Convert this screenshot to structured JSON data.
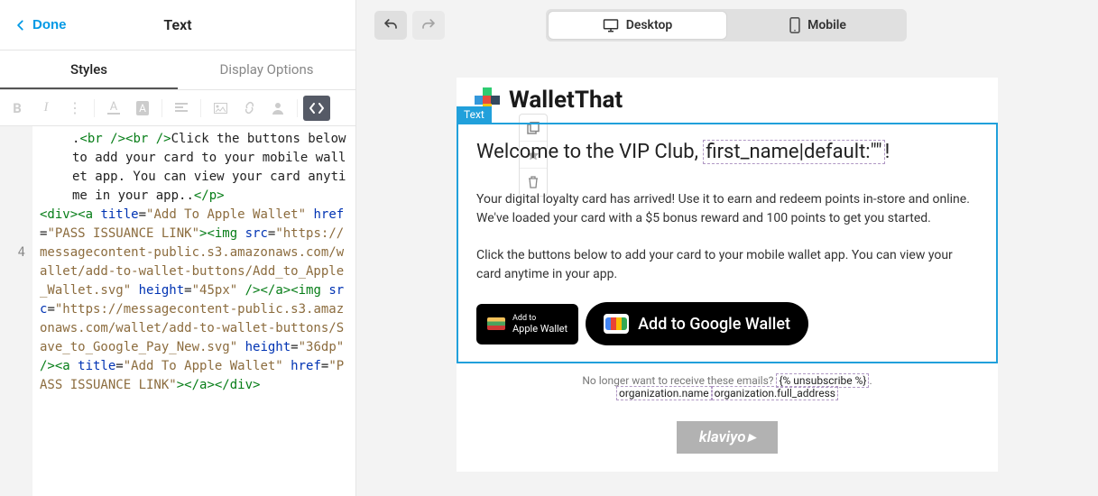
{
  "header": {
    "done_label": "Done",
    "title": "Text"
  },
  "tabs": {
    "styles": "Styles",
    "display": "Display Options"
  },
  "code": {
    "line_number": "4",
    "pre_text": ".",
    "br1": "<br />",
    "br2": "<br />",
    "click_text": "Click the buttons below to add your card to your mobile wallet app. You can view your card anytime in your app.",
    "p_close": "</p>",
    "div_open": "<div>",
    "a_open": "<a",
    "title_attr": " title",
    "eq": "=",
    "title_val": "\"Add To Apple Wallet\"",
    "href_attr": " href",
    "href_val": "\"PASS ISSUANCE LINK\"",
    "gt": ">",
    "img_open": "<img",
    "src_attr": " src",
    "src_val": "\"https://messagecontent-public.s3.amazonaws.com/wallet/add-to-wallet-buttons/Add_to_Apple_Wallet.svg\"",
    "height_attr": " height",
    "height_val": "\"45px\"",
    "self_close": " />",
    "a_close": "</a>",
    "src_val2": "\"https://messagecontent-public.s3.amazonaws.com/wallet/add-to-wallet-buttons/Save_to_Google_Pay_New.svg\"",
    "height_val2": "\"36dp\"",
    "href_val2": "\"PASS ISSUANCE LINK\"",
    "div_close": "</div>"
  },
  "device": {
    "desktop": "Desktop",
    "mobile": "Mobile"
  },
  "email": {
    "brand": "WalletThat",
    "text_label": "Text",
    "welcome_pre": "Welcome to the VIP Club, ",
    "welcome_token": "first_name|default:\"\"",
    "welcome_post": "!",
    "body1": "Your digital loyalty card has arrived! Use it to earn and redeem points in-store and online. We've loaded your card with a $5 bonus reward and 100 points to get you started.",
    "body2": "Click the buttons below to add your card to your mobile wallet app. You can view your card anytime in your app.",
    "apple_small": "Add to",
    "apple_big": "Apple Wallet",
    "google": "Add to Google Wallet",
    "footer_pre": "No longer want to receive these emails? ",
    "unsubscribe": "{% unsubscribe %}",
    "org_name": "organization.name",
    "org_addr": "organization.full_address",
    "klaviyo": "klaviyo"
  }
}
